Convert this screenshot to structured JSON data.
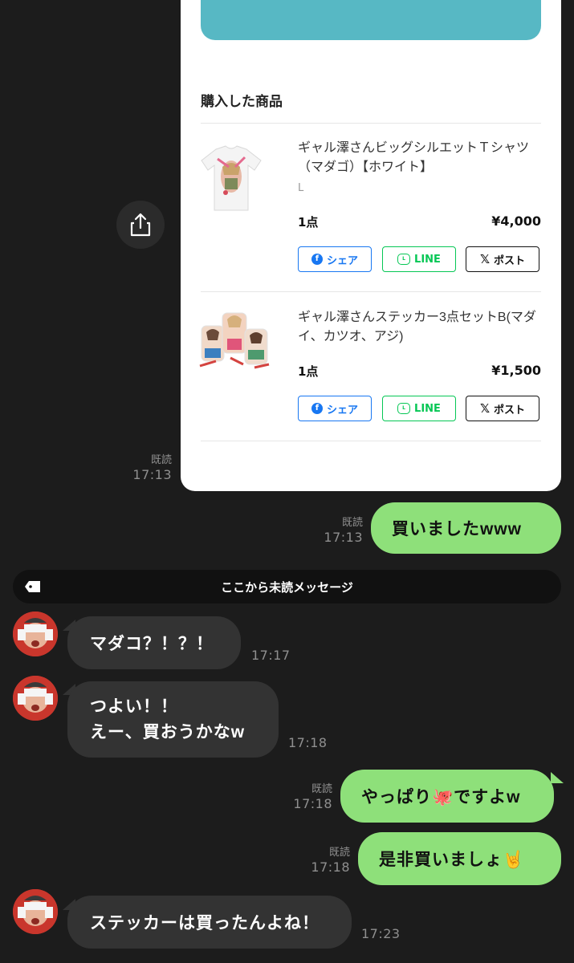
{
  "card": {
    "section_title": "購入した商品",
    "products": [
      {
        "name": "ギャル澤さんビッグシルエットＴシャツ（マダゴ）【ホワイト】",
        "variant": "L",
        "quantity": "1点",
        "price": "¥4,000",
        "share_buttons": {
          "facebook": "シェア",
          "line": "LINE",
          "x": "ポスト"
        }
      },
      {
        "name": "ギャル澤さんステッカー3点セットB(マダイ、カツオ、アジ)",
        "variant": "",
        "quantity": "1点",
        "price": "¥1,500",
        "share_buttons": {
          "facebook": "シェア",
          "line": "LINE",
          "x": "ポスト"
        }
      }
    ]
  },
  "messages": [
    {
      "side": "right",
      "type": "card",
      "read": "既読",
      "time": "17:13"
    },
    {
      "side": "right",
      "text": "買いましたwww",
      "read": "既読",
      "time": "17:13"
    },
    {
      "side": "left",
      "text": "マダコ？！？！",
      "time": "17:17"
    },
    {
      "side": "left",
      "lines": [
        "つよい！！",
        "えー、買おうかなw"
      ],
      "time": "17:18"
    },
    {
      "side": "right",
      "text": "やっぱり🐙ですよw",
      "read": "既読",
      "time": "17:18"
    },
    {
      "side": "right",
      "text": "是非買いましょ🤘",
      "read": "既読",
      "time": "17:18"
    },
    {
      "side": "left",
      "text": "ステッカーは買ったんよね！",
      "time": "17:23"
    }
  ],
  "unread_divider": "ここから未読メッセージ",
  "colors": {
    "background": "#1c1c1c",
    "my_bubble": "#8ee07a",
    "their_bubble": "#333333",
    "accent_teal": "#57b8c4"
  }
}
